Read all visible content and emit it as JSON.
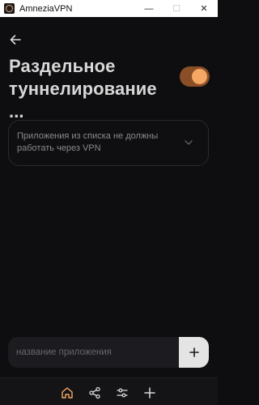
{
  "window": {
    "title": "AmneziaVPN",
    "controls": {
      "minimize": "—",
      "maximize": "☐",
      "close": "✕"
    }
  },
  "header": {
    "title": "Раздельное туннелирование ...",
    "toggle_on": true
  },
  "mode_select": {
    "value": "Приложения из списка не должны работать через VPN"
  },
  "add_app": {
    "placeholder": "название приложения",
    "button_label": "+"
  },
  "bottom_nav": {
    "items": [
      "home-icon",
      "share-icon",
      "settings-sliders-icon",
      "plus-icon"
    ],
    "active": "home-icon"
  },
  "colors": {
    "background": "#0e0e11",
    "accent": "#f4a863",
    "toggle_track": "#8a4f27",
    "title_text": "#d7d7d7",
    "muted_text": "#8a8a8e"
  }
}
